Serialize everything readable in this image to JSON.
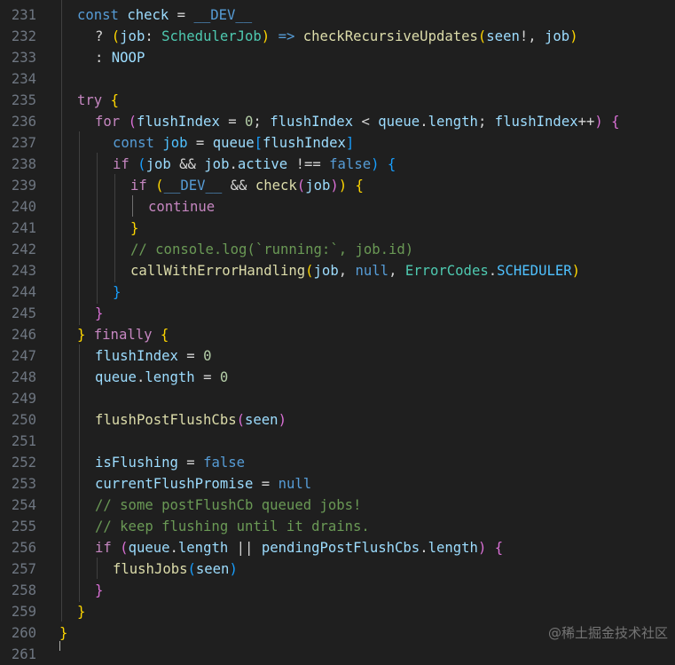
{
  "line_numbers": [
    "231",
    "232",
    "233",
    "234",
    "235",
    "236",
    "237",
    "238",
    "239",
    "240",
    "241",
    "242",
    "243",
    "244",
    "245",
    "246",
    "247",
    "248",
    "249",
    "250",
    "251",
    "252",
    "253",
    "254",
    "255",
    "256",
    "257",
    "258",
    "259",
    "260",
    "261"
  ],
  "tokens": {
    "const": "const",
    "check": "check",
    "eq": " = ",
    "dev": "__DEV__",
    "q": "? ",
    "paren_open": "(",
    "paren_close": ")",
    "job": "job",
    "colon_sp": ": ",
    "scheduler_job": "SchedulerJob",
    "arrow": " => ",
    "check_recursive": "checkRecursiveUpdates",
    "seen": "seen",
    "bang_comma": "!, ",
    "colon2": ": ",
    "noop": "NOOP",
    "try": "try",
    "brace_open": "{",
    "brace_close": "}",
    "for": "for",
    "flush_index": "flushIndex",
    "zero": "0",
    "lt": " < ",
    "queue": "queue",
    "length": "length",
    "semi_sp": "; ",
    "plusplus": "++",
    "bracket_open": "[",
    "bracket_close": "]",
    "if": "if",
    "andand": " && ",
    "active": "active",
    "neq": " !== ",
    "false": "false",
    "continue": "continue",
    "comment_console": "// console.log(`running:`, job.id)",
    "call_with_error": "callWithErrorHandling",
    "null": "null",
    "error_codes": "ErrorCodes",
    "scheduler": "SCHEDULER",
    "comma_sp": ", ",
    "dot": ".",
    "finally": "finally",
    "flush_post": "flushPostFlushCbs",
    "is_flushing": "isFlushing",
    "current_flush_promise": "currentFlushPromise",
    "comment_some": "// some postFlushCb queued jobs!",
    "comment_keep": "// keep flushing until it drains.",
    "oror": " || ",
    "pending_post": "pendingPostFlushCbs",
    "flush_jobs": "flushJobs",
    "sp": " "
  },
  "top_cut_text": "                                                 ",
  "watermark": "@稀土掘金技术社区"
}
